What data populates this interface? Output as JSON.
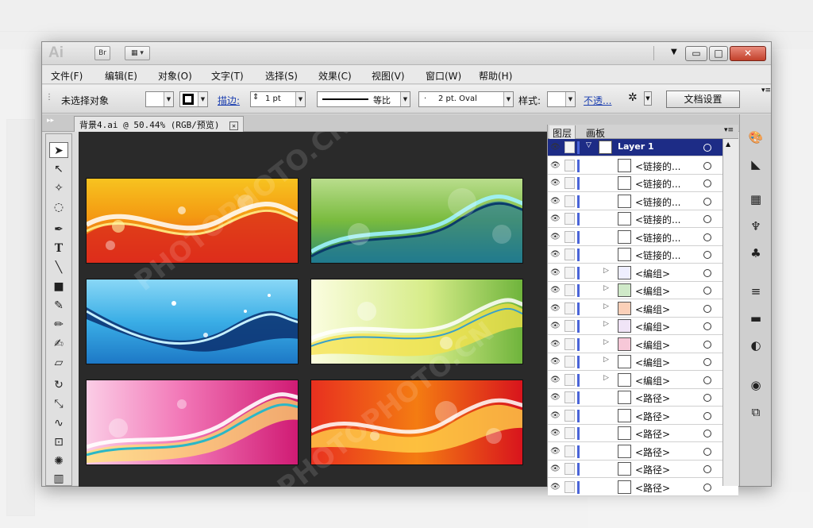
{
  "app": {
    "logo_text": "Ai",
    "bridge_label": "Br",
    "window_controls": {
      "minimize": "▭",
      "restore": "□",
      "close": "✕"
    }
  },
  "menu": {
    "items": [
      "文件(F)",
      "编辑(E)",
      "对象(O)",
      "文字(T)",
      "选择(S)",
      "效果(C)",
      "视图(V)",
      "窗口(W)",
      "帮助(H)"
    ]
  },
  "control_bar": {
    "selection_status": "未选择对象",
    "stroke_label": "描边:",
    "stroke_weight": "1 pt",
    "stroke_profile": "等比",
    "brush": "2 pt. Oval",
    "style_label": "样式:",
    "opacity_label": "不透...",
    "doc_setup_button": "文档设置"
  },
  "document": {
    "tab_title": "背景4.ai @ 50.44% (RGB/预览)"
  },
  "layers_panel": {
    "tabs": [
      "图层",
      "画板"
    ],
    "rows": [
      {
        "name": "Layer 1",
        "type": "layer"
      },
      {
        "name": "<链接的...",
        "type": "linked"
      },
      {
        "name": "<链接的...",
        "type": "linked"
      },
      {
        "name": "<链接的...",
        "type": "linked"
      },
      {
        "name": "<链接的...",
        "type": "linked"
      },
      {
        "name": "<链接的...",
        "type": "linked"
      },
      {
        "name": "<链接的...",
        "type": "linked"
      },
      {
        "name": "<编组>",
        "type": "group"
      },
      {
        "name": "<编组>",
        "type": "group"
      },
      {
        "name": "<编组>",
        "type": "group"
      },
      {
        "name": "<编组>",
        "type": "group"
      },
      {
        "name": "<编组>",
        "type": "group"
      },
      {
        "name": "<编组>",
        "type": "group"
      },
      {
        "name": "<编组>",
        "type": "group"
      },
      {
        "name": "<路径>",
        "type": "path"
      },
      {
        "name": "<路径>",
        "type": "path"
      },
      {
        "name": "<路径>",
        "type": "path"
      },
      {
        "name": "<路径>",
        "type": "path"
      },
      {
        "name": "<路径>",
        "type": "path"
      },
      {
        "name": "<路径>",
        "type": "path"
      }
    ]
  },
  "artboards": [
    {
      "name": "orange-wave-banner",
      "colors": [
        "#f7b90d",
        "#e84a1d"
      ]
    },
    {
      "name": "green-wave-banner",
      "colors": [
        "#7bbd3a",
        "#1e7d8a"
      ]
    },
    {
      "name": "blue-wave-banner",
      "colors": [
        "#5ac3ee",
        "#0e3f86"
      ]
    },
    {
      "name": "lime-wave-banner",
      "colors": [
        "#f2f7b0",
        "#6bb43c"
      ]
    },
    {
      "name": "pink-wave-banner",
      "colors": [
        "#f277b7",
        "#d01b74"
      ]
    },
    {
      "name": "red-wave-banner",
      "colors": [
        "#f47c12",
        "#d8141d"
      ]
    }
  ],
  "tools": [
    "selection-tool",
    "direct-selection-tool",
    "magic-wand-tool",
    "lasso-tool",
    "pen-tool",
    "type-tool",
    "line-tool",
    "rectangle-tool",
    "paintbrush-tool",
    "pencil-tool",
    "blob-brush-tool",
    "eraser-tool",
    "rotate-tool",
    "scale-tool",
    "warp-tool",
    "free-transform-tool",
    "symbol-sprayer-tool",
    "column-graph-tool"
  ],
  "right_panel_icons": [
    "color-icon",
    "color-guide-icon",
    "swatches-icon",
    "brushes-icon",
    "symbols-icon",
    "stroke-icon",
    "gradient-icon",
    "transparency-icon",
    "appearance-icon",
    "graphic-styles-icon"
  ],
  "watermark_text": "PHOTOPHOTO.CN"
}
